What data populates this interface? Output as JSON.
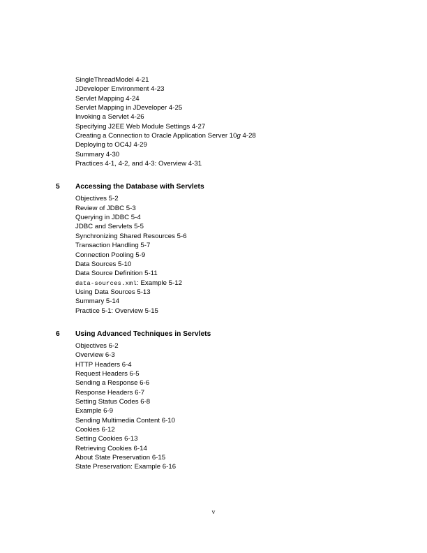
{
  "document": {
    "kind": "table-of-contents",
    "folio": "v"
  },
  "continued_chapter": {
    "entries": [
      {
        "text": "SingleThreadModel 4-21"
      },
      {
        "text": "JDeveloper Environment  4-23"
      },
      {
        "text": "Servlet Mapping 4-24"
      },
      {
        "text": "Servlet Mapping in JDeveloper 4-25"
      },
      {
        "text": "Invoking a Servlet 4-26"
      },
      {
        "text": "Specifying J2EE Web Module Settings 4-27"
      },
      {
        "prefix": "Creating a Connection to Oracle Application Server 10",
        "italic": "g",
        "suffix": " 4-28"
      },
      {
        "text": "Deploying to OC4J 4-29"
      },
      {
        "text": "Summary 4-30"
      },
      {
        "text": "Practices 4-1, 4-2, and 4-3: Overview 4-31"
      }
    ]
  },
  "chapters": [
    {
      "number": "5",
      "title": "Accessing the Database with Servlets",
      "entries": [
        {
          "text": "Objectives 5-2"
        },
        {
          "text": "Review of JDBC 5-3"
        },
        {
          "text": "Querying in JDBC 5-4"
        },
        {
          "text": "JDBC and Servlets 5-5"
        },
        {
          "text": "Synchronizing Shared Resources 5-6"
        },
        {
          "text": "Transaction Handling 5-7"
        },
        {
          "text": "Connection Pooling 5-9"
        },
        {
          "text": "Data Sources 5-10"
        },
        {
          "text": "Data Source Definition 5-11"
        },
        {
          "mono": "data-sources.xml",
          "suffix": ": Example 5-12"
        },
        {
          "text": "Using Data Sources 5-13"
        },
        {
          "text": "Summary 5-14"
        },
        {
          "text": "Practice 5-1: Overview 5-15"
        }
      ]
    },
    {
      "number": "6",
      "title": "Using Advanced Techniques in Servlets",
      "entries": [
        {
          "text": "Objectives 6-2"
        },
        {
          "text": "Overview 6-3"
        },
        {
          "text": "HTTP Headers 6-4"
        },
        {
          "text": "Request Headers 6-5"
        },
        {
          "text": "Sending a Response 6-6"
        },
        {
          "text": "Response Headers 6-7"
        },
        {
          "text": "Setting Status Codes 6-8"
        },
        {
          "text": "Example 6-9"
        },
        {
          "text": "Sending Multimedia Content 6-10"
        },
        {
          "text": "Cookies 6-12"
        },
        {
          "text": "Setting Cookies 6-13"
        },
        {
          "text": "Retrieving Cookies 6-14"
        },
        {
          "text": "About State Preservation 6-15"
        },
        {
          "text": "State Preservation: Example 6-16"
        }
      ]
    }
  ]
}
